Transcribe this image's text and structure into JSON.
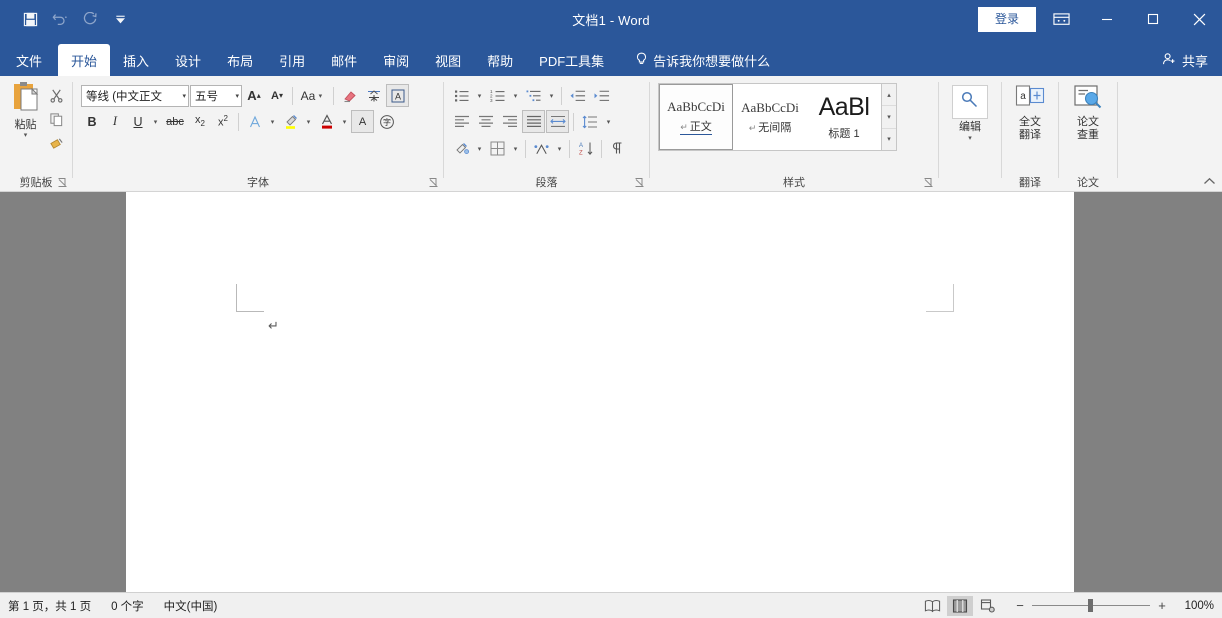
{
  "window": {
    "title": "文档1 - Word",
    "signin_label": "登录",
    "quick_access": [
      {
        "name": "save",
        "icon": "save-icon"
      },
      {
        "name": "undo",
        "icon": "undo-icon"
      },
      {
        "name": "redo",
        "icon": "redo-icon"
      },
      {
        "name": "customize",
        "icon": "customize-quick-access-icon"
      }
    ],
    "controls": {
      "ribbon_display": "ribbon-display-options-icon",
      "minimize": "minimize-icon",
      "maximize": "maximize-icon",
      "close": "close-icon"
    },
    "accent_color": "#2b579a"
  },
  "tabs": [
    {
      "label": "文件",
      "active": false
    },
    {
      "label": "开始",
      "active": true
    },
    {
      "label": "插入",
      "active": false
    },
    {
      "label": "设计",
      "active": false
    },
    {
      "label": "布局",
      "active": false
    },
    {
      "label": "引用",
      "active": false
    },
    {
      "label": "邮件",
      "active": false
    },
    {
      "label": "审阅",
      "active": false
    },
    {
      "label": "视图",
      "active": false
    },
    {
      "label": "帮助",
      "active": false
    },
    {
      "label": "PDF工具集",
      "active": false
    }
  ],
  "tellme": {
    "label": "告诉我你想要做什么",
    "icon": "lightbulb-icon"
  },
  "share": {
    "label": "共享",
    "icon": "share-person-icon"
  },
  "ribbon": {
    "collapse_icon": "chevron-up-icon",
    "groups": {
      "clipboard": {
        "label": "剪贴板",
        "paste_label": "粘贴",
        "buttons": [
          {
            "name": "cut",
            "label": "剪切"
          },
          {
            "name": "copy",
            "label": "复制"
          },
          {
            "name": "format-painter",
            "label": "格式刷"
          }
        ]
      },
      "font": {
        "label": "字体",
        "font_name": "等线 (中文正文",
        "font_size": "五号",
        "grow_label": "A",
        "shrink_label": "A",
        "case_label": "Aa",
        "bold": "B",
        "italic": "I",
        "underline": "U",
        "strikethrough": "abc",
        "subscript": "x₂",
        "superscript": "x²",
        "buttons": [
          {
            "name": "clear-formatting",
            "label": "清除所有格式"
          },
          {
            "name": "phonetic-guide",
            "label": "拼音指南"
          },
          {
            "name": "character-border",
            "label": "字符边框"
          },
          {
            "name": "text-effects",
            "label": "文本效果和版式"
          },
          {
            "name": "text-highlight",
            "label": "文本突出显示颜色",
            "color": "#ffff00"
          },
          {
            "name": "font-color",
            "label": "字体颜色",
            "color": "#cc0000"
          },
          {
            "name": "character-shading",
            "label": "字符底纹"
          },
          {
            "name": "enclose-characters",
            "label": "带圈字符"
          }
        ]
      },
      "paragraph": {
        "label": "段落",
        "buttons": [
          {
            "name": "bullets",
            "label": "项目符号"
          },
          {
            "name": "numbering",
            "label": "编号"
          },
          {
            "name": "multilevel-list",
            "label": "多级列表"
          },
          {
            "name": "decrease-indent",
            "label": "减少缩进量"
          },
          {
            "name": "increase-indent",
            "label": "增加缩进量"
          },
          {
            "name": "align-left",
            "label": "左对齐"
          },
          {
            "name": "align-center",
            "label": "居中"
          },
          {
            "name": "align-right",
            "label": "右对齐"
          },
          {
            "name": "justify",
            "label": "两端对齐"
          },
          {
            "name": "distribute",
            "label": "分散对齐"
          },
          {
            "name": "line-spacing",
            "label": "行和段落间距"
          },
          {
            "name": "shading",
            "label": "底纹"
          },
          {
            "name": "borders",
            "label": "边框"
          },
          {
            "name": "asian-layout",
            "label": "中文版式"
          },
          {
            "name": "sort",
            "label": "排序"
          },
          {
            "name": "show-marks",
            "label": "显示/隐藏编辑标记"
          }
        ]
      },
      "styles": {
        "label": "样式",
        "cards": [
          {
            "preview": "AaBbCcDi",
            "name": "正文",
            "selected": true,
            "heading": false
          },
          {
            "preview": "AaBbCcDi",
            "name": "无间隔",
            "selected": false,
            "heading": false
          },
          {
            "preview": "AaBl",
            "name": "标题 1",
            "selected": false,
            "heading": true
          }
        ]
      },
      "editing": {
        "label": "编辑",
        "button_label": "编辑",
        "icon": "magnifier-key-icon"
      },
      "translate": {
        "label": "翻译",
        "button_label_line1": "全文",
        "button_label_line2": "翻译",
        "icon": "translate-icon"
      },
      "thesis": {
        "label": "论文",
        "button_label_line1": "论文",
        "button_label_line2": "查重",
        "icon": "plagiarism-check-icon"
      }
    }
  },
  "document": {
    "paragraph_mark": "↵"
  },
  "status": {
    "page_info": "第 1 页，共 1 页",
    "word_count": "0 个字",
    "language": "中文(中国)",
    "views": [
      {
        "name": "read-mode",
        "label": "阅读视图",
        "active": false
      },
      {
        "name": "print-layout",
        "label": "页面视图",
        "active": true
      },
      {
        "name": "web-layout",
        "label": "Web 版式视图",
        "active": false
      }
    ],
    "zoom_out": "−",
    "zoom_in": "+",
    "zoom_level": "100%"
  }
}
